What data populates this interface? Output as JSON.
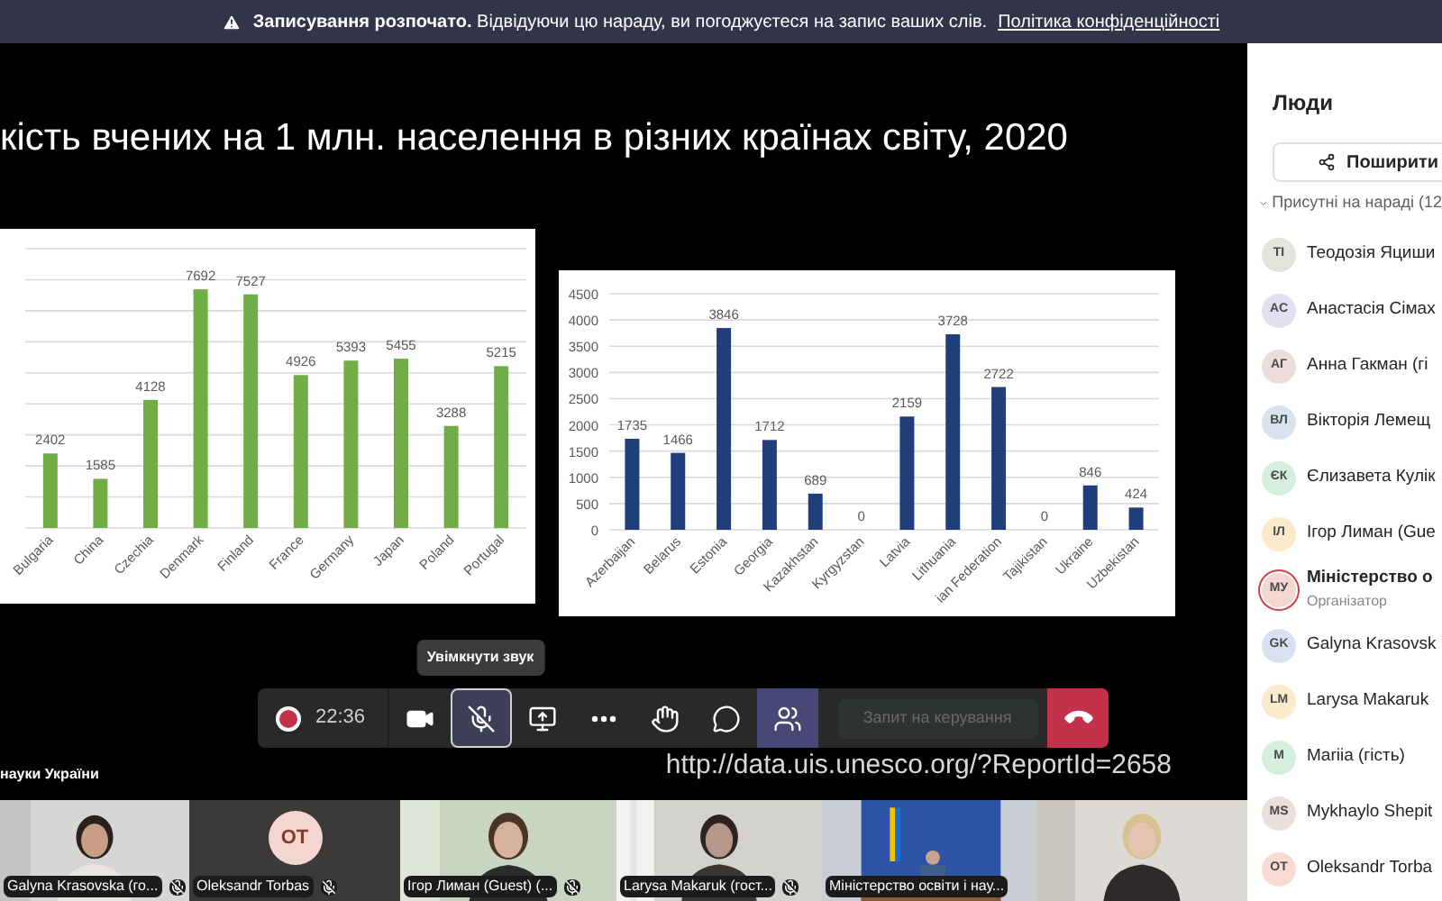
{
  "banner": {
    "bold": "Записування розпочато.",
    "text": "Відвідуючи цю нараду, ви погоджуєтеся на запис ваших слів.",
    "link": "Політика конфіденційності"
  },
  "slide": {
    "title": "кість вчених на 1 млн. населення в різних країнах світу, 2020",
    "charts": [
      {
        "chart_data": {
          "type": "bar",
          "categories": [
            "Bulgaria",
            "China",
            "Czechia",
            "Denmark",
            "Finland",
            "France",
            "Germany",
            "Japan",
            "Poland",
            "Portugal"
          ],
          "series": [
            {
              "color": "#70ad47",
              "values": [
                2402,
                1585,
                4128,
                7692,
                7527,
                4926,
                5393,
                5455,
                3288,
                5215
              ]
            }
          ],
          "ylim": [
            0,
            9000
          ],
          "grid": true,
          "data_labels": true
        }
      },
      {
        "chart_data": {
          "type": "bar",
          "categories": [
            "Azerbaijan",
            "Belarus",
            "Estonia",
            "Georgia",
            "Kazakhstan",
            "Kyrgyzstan",
            "Latvia",
            "Lithuania",
            "ian Federation",
            "Tajikistan",
            "Ukraine",
            "Uzbekistan"
          ],
          "series": [
            {
              "color": "#203f7a",
              "values": [
                1735,
                1466,
                3846,
                1712,
                689,
                0,
                2159,
                3728,
                2722,
                0,
                846,
                424
              ]
            }
          ],
          "ylim": [
            0,
            4500
          ],
          "yticks": [
            0,
            500,
            1000,
            1500,
            2000,
            2500,
            3000,
            3500,
            4000,
            4500
          ],
          "grid": true,
          "data_labels": true
        }
      }
    ],
    "footer": "науки України",
    "source": "http://data.uis.unesco.org/?ReportId=2658"
  },
  "call_controls": {
    "recording": true,
    "timer": "22:36",
    "tooltip": "Увімкнути звук",
    "buttons": [
      {
        "kind": "camera",
        "selected": false,
        "focused": false
      },
      {
        "kind": "mic_off",
        "selected": false,
        "focused": true
      },
      {
        "kind": "share",
        "selected": false,
        "focused": false
      },
      {
        "kind": "more",
        "selected": false,
        "focused": false
      },
      {
        "kind": "hand",
        "selected": false,
        "focused": false
      },
      {
        "kind": "chat",
        "selected": false,
        "focused": false
      },
      {
        "kind": "people",
        "selected": true,
        "focused": false
      }
    ],
    "control_request": {
      "label": "Запит на керування",
      "disabled": true
    }
  },
  "tiles": [
    {
      "kind": "picture",
      "name": "Galyna Krasovska (го...",
      "muted": true
    },
    {
      "kind": "avatar",
      "initials": "OT",
      "name": "Oleksandr Torbas",
      "muted": true
    },
    {
      "kind": "picture",
      "name": "Ігор Лиман (Guest) (...",
      "muted": true
    },
    {
      "kind": "picture",
      "name": "Larysa Makaruk (гост...",
      "muted": true
    },
    {
      "kind": "picture",
      "name": "Міністерство освіти і нау...",
      "muted": false
    },
    {
      "kind": "picture"
    }
  ],
  "people": {
    "title": "Люди",
    "share_button": "Поширити",
    "section": {
      "label": "Присутні на нараді (12",
      "expanded": true
    },
    "items": [
      {
        "kind": "member",
        "initials": "TI",
        "name": "Теодозія Яциши",
        "color": "#e4e4dc"
      },
      {
        "kind": "member",
        "initials": "AC",
        "name": "Анастасія Сімах",
        "color": "#e3def2"
      },
      {
        "kind": "member",
        "initials": "АГ",
        "name": "Анна Гакман (гі",
        "color": "#eddcdc"
      },
      {
        "kind": "member",
        "initials": "ВЛ",
        "name": "Вікторія Лемещ",
        "color": "#d9e3ef"
      },
      {
        "kind": "member",
        "initials": "ЄК",
        "name": "Єлизавета Кулік",
        "color": "#d6eedd"
      },
      {
        "kind": "member",
        "initials": "ІЛ",
        "name": "Ігор Лиман (Gue",
        "color": "#fbeacb"
      },
      {
        "kind": "organizer",
        "initials": "МУ",
        "name": "Міністерство о",
        "role": "Організатор",
        "color": "#f6d6d2"
      },
      {
        "kind": "member",
        "initials": "GK",
        "name": "Galyna Krasovsk",
        "color": "#d8e1f1"
      },
      {
        "kind": "member",
        "initials": "LM",
        "name": "Larysa Makaruk",
        "color": "#fcebcc"
      },
      {
        "kind": "member",
        "initials": "M",
        "name": "Mariia (гість)",
        "color": "#d6eedd"
      },
      {
        "kind": "member",
        "initials": "MS",
        "name": "Mykhaylo Shepit",
        "color": "#eadfdc"
      },
      {
        "kind": "member",
        "initials": "OT",
        "name": "Oleksandr Torba",
        "color": "#f9dbd3"
      }
    ]
  }
}
